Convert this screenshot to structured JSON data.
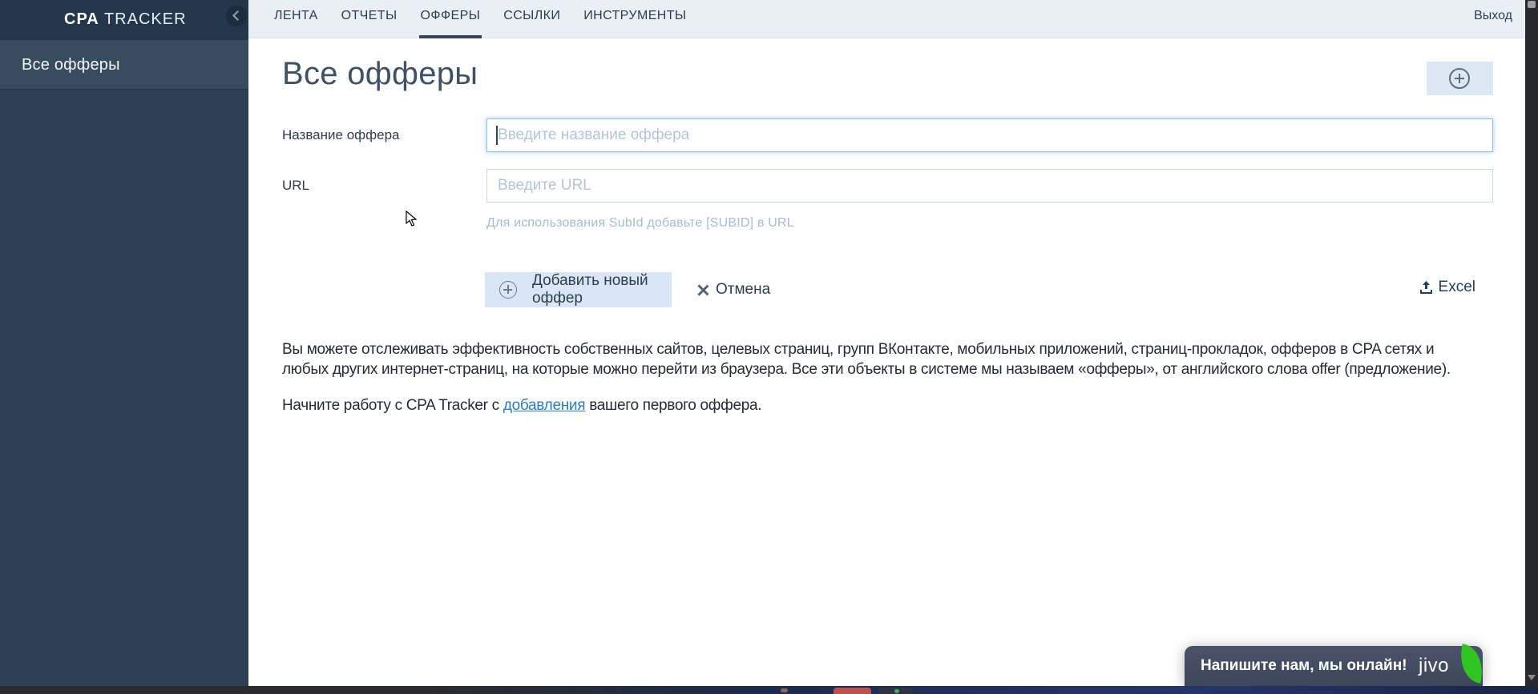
{
  "brand": {
    "bold": "CPA",
    "rest": "TRACKER"
  },
  "sidebar": {
    "items": [
      {
        "label": "Все офферы",
        "active": true
      }
    ]
  },
  "nav": {
    "tabs": [
      {
        "label": "ЛЕНТА",
        "active": false
      },
      {
        "label": "ОТЧЕТЫ",
        "active": false
      },
      {
        "label": "ОФФЕРЫ",
        "active": true
      },
      {
        "label": "ССЫЛКИ",
        "active": false
      },
      {
        "label": "ИНСТРУМЕНТЫ",
        "active": false
      }
    ],
    "logout_label": "Выход"
  },
  "page": {
    "title": "Все офферы"
  },
  "form": {
    "name_label": "Название оффера",
    "name_placeholder": "Введите название оффера",
    "name_value": "",
    "url_label": "URL",
    "url_placeholder": "Введите URL",
    "url_value": "",
    "hint": "Для использования SubId добавьте [SUBID] в URL",
    "submit_label": "Добавить новый оффер",
    "cancel_label": "Отмена",
    "excel_label": "Excel"
  },
  "info": {
    "paragraph1": "Вы можете отслеживать эффективность собственных сайтов, целевых страниц, групп ВКонтакте, мобильных приложений, страниц-прокладок, офферов в CPA сетях и любых других интернет-страниц, на которые можно перейти из браузера. Все эти объекты в системе мы называем «офферы», от английского слова offer (предложение).",
    "paragraph2_before": "Начните работу с CPA Tracker с ",
    "paragraph2_link": "добавления",
    "paragraph2_after": " вашего первого оффера."
  },
  "chat": {
    "message": "Напишите нам, мы онлайн!",
    "brand": "jivo"
  },
  "colors": {
    "sidebar_bg": "#2e4154",
    "sidebar_header_bg": "#24364a",
    "sidebar_active_bg": "#384c60",
    "nav_bg": "#e9eff5",
    "nav_text": "#2b3e52",
    "button_bg": "#d9e7f4",
    "link_blue": "#2e7cc7",
    "focus_border": "#8fc0e8",
    "hint_text": "#a3bdd3",
    "jivo_bg": "#434d61",
    "jivo_green": "#31c522"
  }
}
